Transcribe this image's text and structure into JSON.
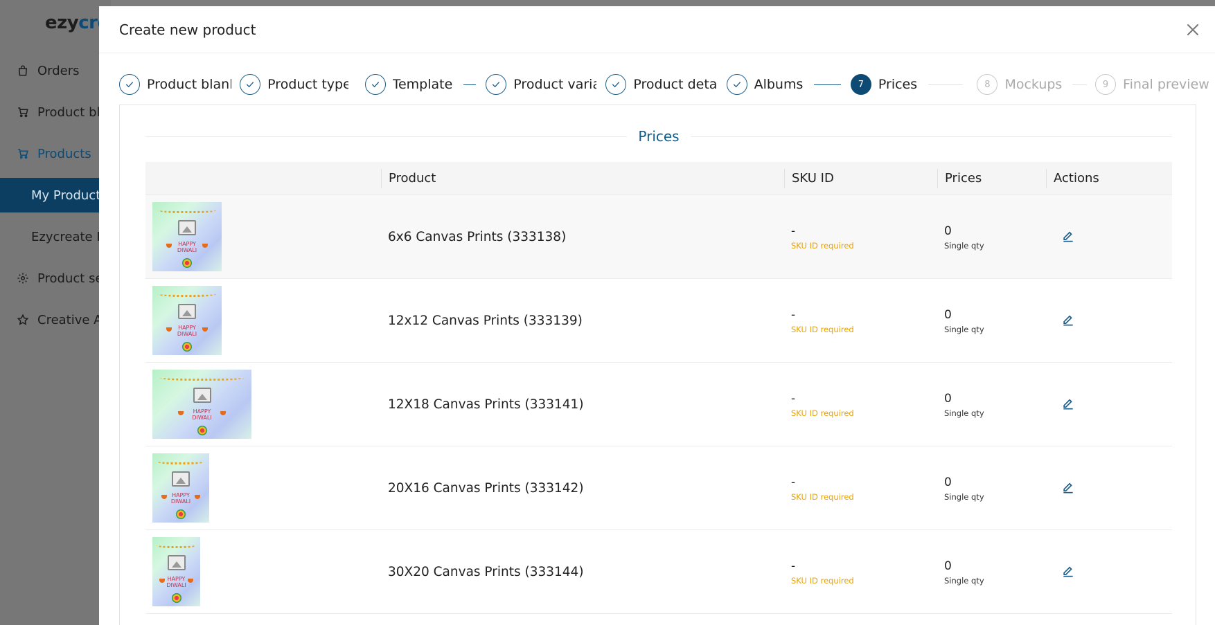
{
  "app": {
    "logo_dark": "ezy",
    "logo_blue": "cre"
  },
  "sidebar": {
    "items": [
      {
        "label": "Orders",
        "icon": "bag-icon"
      },
      {
        "label": "Product blanks",
        "icon": "cart-icon"
      },
      {
        "label": "Products",
        "icon": "cart-icon"
      },
      {
        "label": "My Products"
      },
      {
        "label": "Ezycreate Products"
      },
      {
        "label": "Product settings",
        "icon": "gear-icon"
      },
      {
        "label": "Creative Assets",
        "icon": "star-icon"
      }
    ]
  },
  "modal": {
    "title": "Create new product",
    "close_icon": "close-icon"
  },
  "stepper": {
    "steps": [
      {
        "num": "1",
        "label": "Product blank",
        "status": "done"
      },
      {
        "num": "2",
        "label": "Product type",
        "status": "done"
      },
      {
        "num": "3",
        "label": "Template",
        "status": "done"
      },
      {
        "num": "4",
        "label": "Product variants",
        "status": "done"
      },
      {
        "num": "5",
        "label": "Product details",
        "status": "done"
      },
      {
        "num": "6",
        "label": "Albums",
        "status": "done"
      },
      {
        "num": "7",
        "label": "Prices",
        "status": "current"
      },
      {
        "num": "8",
        "label": "Mockups",
        "status": "pending"
      },
      {
        "num": "9",
        "label": "Final preview",
        "status": "pending"
      }
    ]
  },
  "prices": {
    "section_title": "Prices",
    "columns": [
      "Product",
      "SKU ID",
      "Prices",
      "Actions"
    ],
    "rows": [
      {
        "product": "6x6 Canvas Prints (333138)",
        "sku": "-",
        "sku_note": "SKU ID required",
        "price": "0",
        "price_note": "Single qty"
      },
      {
        "product": "12x12 Canvas Prints (333139)",
        "sku": "-",
        "sku_note": "SKU ID required",
        "price": "0",
        "price_note": "Single qty"
      },
      {
        "product": "12X18 Canvas Prints (333141)",
        "sku": "-",
        "sku_note": "SKU ID required",
        "price": "0",
        "price_note": "Single qty"
      },
      {
        "product": "20X16 Canvas Prints (333142)",
        "sku": "-",
        "sku_note": "SKU ID required",
        "price": "0",
        "price_note": "Single qty"
      },
      {
        "product": "30X20 Canvas Prints (333144)",
        "sku": "-",
        "sku_note": "SKU ID required",
        "price": "0",
        "price_note": "Single qty"
      }
    ]
  },
  "thumb_text": {
    "line1": "HAPPY",
    "line2": "DIWALI"
  },
  "colors": {
    "primary": "#0d4a74",
    "warning": "#e9a100",
    "section_title": "#0f5d8c"
  }
}
